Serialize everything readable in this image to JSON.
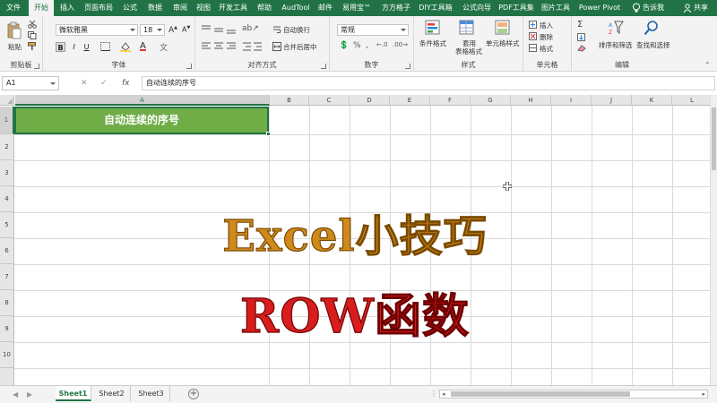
{
  "tabs": [
    {
      "label": "文件",
      "active": false
    },
    {
      "label": "开始",
      "active": true
    },
    {
      "label": "插入",
      "active": false
    },
    {
      "label": "页面布局",
      "active": false
    },
    {
      "label": "公式",
      "active": false
    },
    {
      "label": "数据",
      "active": false
    },
    {
      "label": "审阅",
      "active": false
    },
    {
      "label": "视图",
      "active": false
    },
    {
      "label": "开发工具",
      "active": false
    },
    {
      "label": "帮助",
      "active": false
    },
    {
      "label": "AudTool",
      "active": false
    },
    {
      "label": "邮件",
      "active": false
    },
    {
      "label": "易用宝™",
      "active": false
    },
    {
      "label": "方方格子",
      "active": false
    },
    {
      "label": "DIY工具箱",
      "active": false
    },
    {
      "label": "公式向导",
      "active": false
    },
    {
      "label": "PDF工具集",
      "active": false
    },
    {
      "label": "图片工具",
      "active": false
    },
    {
      "label": "Power Pivot",
      "active": false
    }
  ],
  "tell_me": "告诉我",
  "share": "共享",
  "ribbon": {
    "clipboard": {
      "label": "剪贴板",
      "paste": "粘贴"
    },
    "font": {
      "label": "字体",
      "name": "微软雅黑",
      "size": "18",
      "bold": "B",
      "italic": "I",
      "underline": "U"
    },
    "alignment": {
      "label": "对齐方式",
      "wrap": "自动换行",
      "merge": "合并后居中"
    },
    "number": {
      "label": "数字",
      "format": "常规"
    },
    "styles": {
      "label": "样式",
      "conditional": "条件格式",
      "table_1": "套用",
      "table_2": "表格格式",
      "cell_styles": "单元格样式"
    },
    "cells": {
      "label": "单元格",
      "insert": "插入",
      "delete": "删除",
      "format": "格式"
    },
    "editing": {
      "label": "编辑",
      "sort": "排序和筛选",
      "find": "查找和选择"
    }
  },
  "formula_bar": {
    "name_box": "A1",
    "fx": "fx",
    "content": "自动连续的序号"
  },
  "columns": [
    "A",
    "B",
    "C",
    "D",
    "E",
    "F",
    "G",
    "H",
    "I",
    "J",
    "K",
    "L"
  ],
  "rows": [
    "1",
    "2",
    "3",
    "4",
    "5",
    "6",
    "7",
    "8",
    "9",
    "10"
  ],
  "cell_a1": "自动连续的序号",
  "overlay": {
    "line1": "Excel小技巧",
    "line2": "ROW函数"
  },
  "sheets": [
    {
      "label": "Sheet1",
      "active": true
    },
    {
      "label": "Sheet2",
      "active": false
    },
    {
      "label": "Sheet3",
      "active": false
    }
  ],
  "add_sheet": "+",
  "colors": {
    "accent": "#217346",
    "header_fill": "#70ad47",
    "title_orange": "#d08a1c",
    "title_red": "#d81d1d"
  }
}
